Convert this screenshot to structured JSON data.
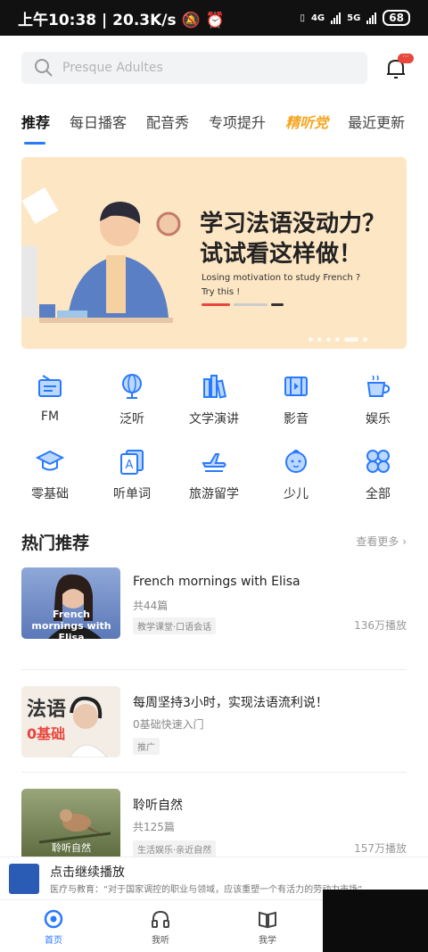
{
  "status": {
    "time": "上午10:38",
    "speed": "20.3K/s",
    "net1": "4G",
    "net2": "5G",
    "battery": "68"
  },
  "search": {
    "placeholder": "Presque Adultes"
  },
  "bell": {
    "badge": "···"
  },
  "tabs": [
    {
      "label": "推荐"
    },
    {
      "label": "每日播客"
    },
    {
      "label": "配音秀"
    },
    {
      "label": "专项提升"
    },
    {
      "label": "精听党"
    },
    {
      "label": "最近更新"
    }
  ],
  "banner": {
    "title_line1": "学习法语没动力？",
    "title_line2": "试试看这样做！",
    "sub_line1": "Losing motivation to study French ?",
    "sub_line2": "Try this !"
  },
  "categories": [
    {
      "label": "FM",
      "icon": "radio-icon"
    },
    {
      "label": "泛听",
      "icon": "globe-icon"
    },
    {
      "label": "文学演讲",
      "icon": "books-icon"
    },
    {
      "label": "影音",
      "icon": "film-icon"
    },
    {
      "label": "娱乐",
      "icon": "cup-icon"
    },
    {
      "label": "零基础",
      "icon": "graduation-cap-icon"
    },
    {
      "label": "听单词",
      "icon": "word-card-icon"
    },
    {
      "label": "旅游留学",
      "icon": "airplane-icon"
    },
    {
      "label": "少儿",
      "icon": "baby-face-icon"
    },
    {
      "label": "全部",
      "icon": "grid-icon"
    }
  ],
  "section": {
    "title": "热门推荐",
    "more": "查看更多"
  },
  "items": [
    {
      "title": "French mornings with Elisa",
      "count": "共44篇",
      "tag": "教学课堂·口语会话",
      "plays": "136万播放",
      "thumb_text": "French mornings with Elisa"
    },
    {
      "title": "每周坚持3小时，实现法语流利说！",
      "count": "0基础快速入门",
      "tag": "推广",
      "plays": "",
      "thumb_text1": "法语",
      "thumb_text2": "0基础"
    },
    {
      "title": "聆听自然",
      "count": "共125篇",
      "tag": "生活娱乐·亲近自然",
      "plays": "157万播放",
      "thumb_text": "聆听自然"
    }
  ],
  "player": {
    "title": "点击继续播放",
    "subtitle": "医疗与教育：“对于国家调控的职业与领域，应该重塑一个有活力的劳动力市场”"
  },
  "nav": [
    {
      "label": "首页"
    },
    {
      "label": "我听"
    },
    {
      "label": "我学"
    }
  ],
  "colors": {
    "accent": "#2979ff",
    "banner_bg": "#fde6c4",
    "special_tab": "#f5a623"
  }
}
